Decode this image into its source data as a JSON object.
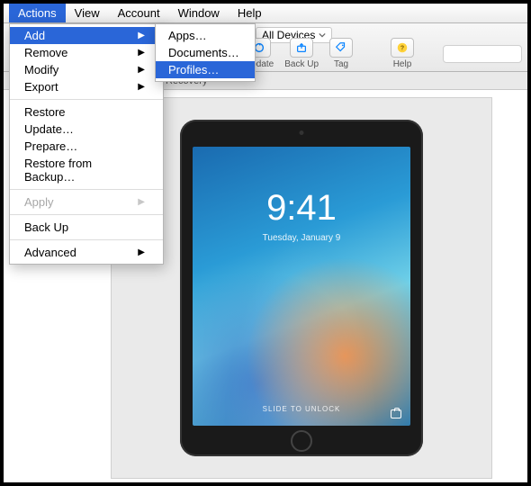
{
  "menubar": {
    "items": [
      "Actions",
      "View",
      "Account",
      "Window",
      "Help"
    ],
    "active_index": 0
  },
  "actions_menu": {
    "add": "Add",
    "remove": "Remove",
    "modify": "Modify",
    "export": "Export",
    "restore": "Restore",
    "update": "Update…",
    "prepare": "Prepare…",
    "restore_backup": "Restore from Backup…",
    "apply": "Apply",
    "backup": "Back Up",
    "advanced": "Advanced"
  },
  "add_submenu": {
    "apps": "Apps…",
    "documents": "Documents…",
    "profiles": "Profiles…"
  },
  "toolbar": {
    "device_selector": "All Devices",
    "update": "Update",
    "backup": "Back Up",
    "tag": "Tag",
    "help": "Help"
  },
  "tabbar": {
    "recovery": "Recovery"
  },
  "lockscreen": {
    "time": "9:41",
    "date": "Tuesday, January 9",
    "slide": "SLIDE TO UNLOCK"
  }
}
